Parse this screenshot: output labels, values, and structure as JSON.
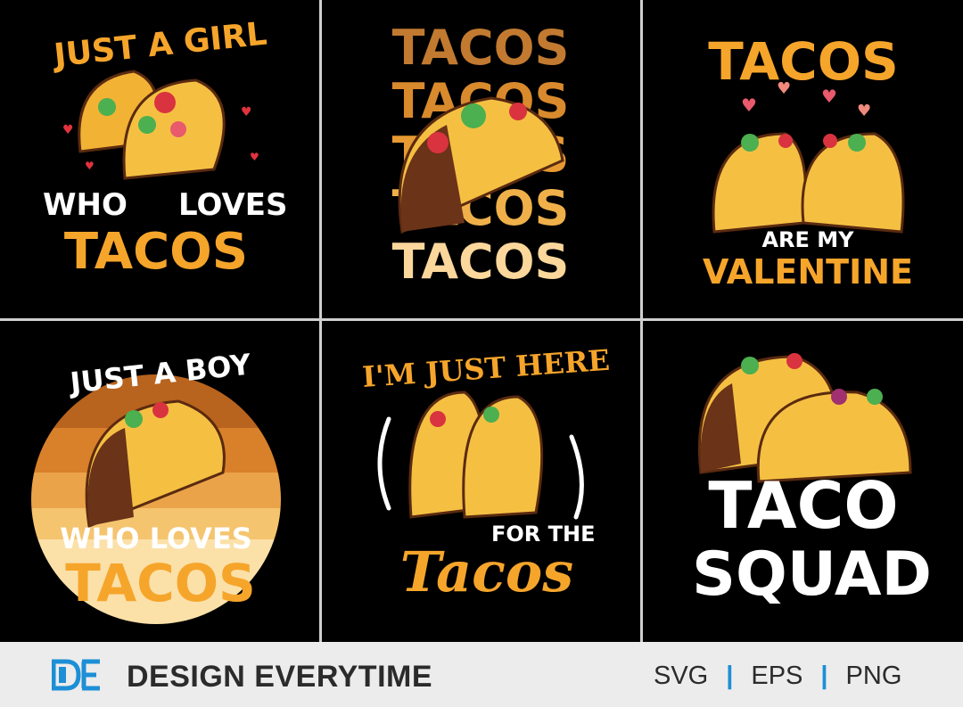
{
  "designs": {
    "d1": {
      "line1": "JUST A GIRL",
      "line2a": "WHO",
      "line2b": "LOVES",
      "line3": "TACOS"
    },
    "d2": {
      "rows": [
        "TACOS",
        "TACOS",
        "TACOS",
        "TACOS",
        "TACOS"
      ]
    },
    "d3": {
      "line1": "TACOS",
      "line2": "ARE MY",
      "line3": "VALENTINE"
    },
    "d4": {
      "line1": "JUST A BOY",
      "line2": "WHO LOVES",
      "line3": "TACOS"
    },
    "d5": {
      "line1": "I'M JUST HERE",
      "line2": "FOR THE",
      "line3": "Tacos"
    },
    "d6": {
      "line1": "TACO",
      "line2": "SQUAD"
    }
  },
  "footer": {
    "brand": "DESIGN EVERYTIME",
    "formats": [
      "SVG",
      "EPS",
      "PNG"
    ]
  },
  "colors": {
    "accent": "#f6a52b",
    "brand_blue": "#1c8fd6",
    "panel_bg": "#000000"
  }
}
